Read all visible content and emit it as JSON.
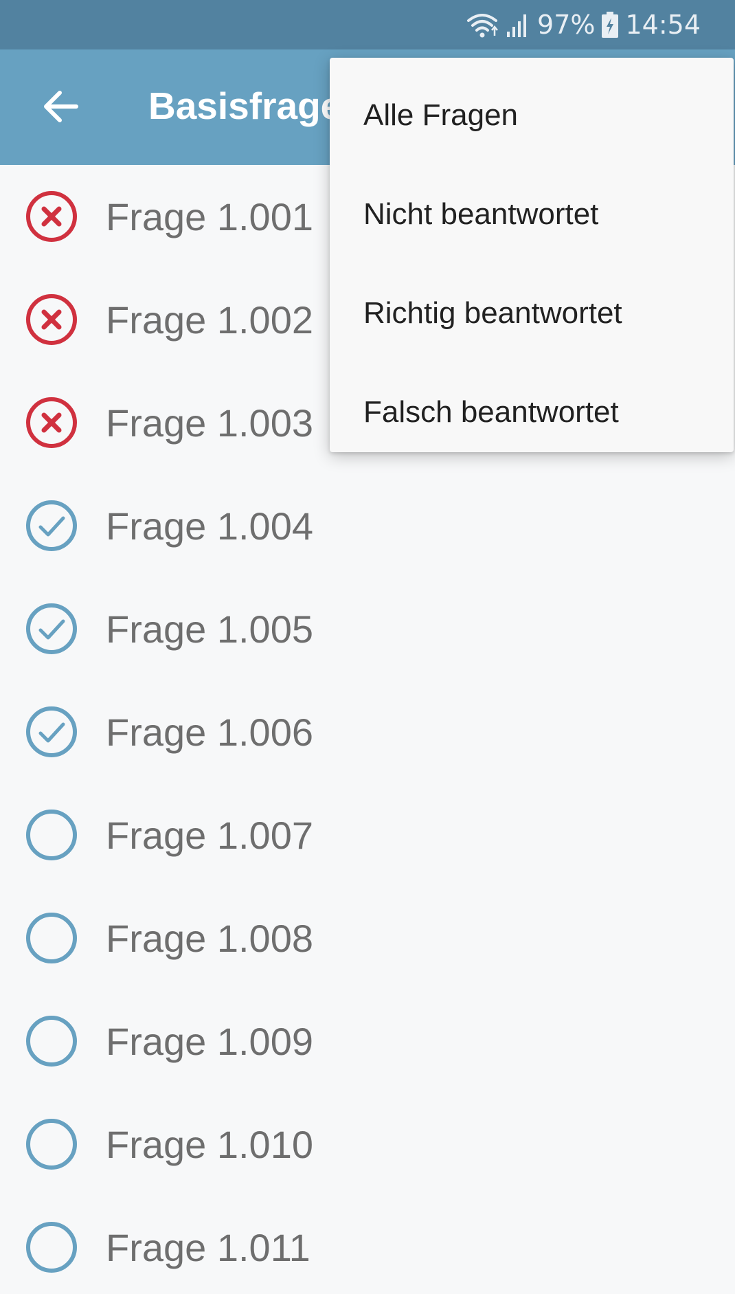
{
  "status_bar": {
    "battery": "97%",
    "time": "14:54",
    "icons": [
      "wifi-icon",
      "signal-icon",
      "battery-charging-icon"
    ]
  },
  "app_bar": {
    "back_icon": "arrow-left-icon",
    "title": "Basisfragen"
  },
  "questions": [
    {
      "label": "Frage 1.001",
      "status": "wrong"
    },
    {
      "label": "Frage 1.002",
      "status": "wrong"
    },
    {
      "label": "Frage 1.003",
      "status": "wrong"
    },
    {
      "label": "Frage 1.004",
      "status": "correct"
    },
    {
      "label": "Frage 1.005",
      "status": "correct"
    },
    {
      "label": "Frage 1.006",
      "status": "correct"
    },
    {
      "label": "Frage 1.007",
      "status": "unanswered"
    },
    {
      "label": "Frage 1.008",
      "status": "unanswered"
    },
    {
      "label": "Frage 1.009",
      "status": "unanswered"
    },
    {
      "label": "Frage 1.010",
      "status": "unanswered"
    },
    {
      "label": "Frage 1.011",
      "status": "unanswered"
    }
  ],
  "filter_menu": {
    "items": [
      "Alle Fragen",
      "Nicht beantwortet",
      "Richtig beantwortet",
      "Falsch beantwortet"
    ]
  },
  "colors": {
    "status_bar": "#5282a0",
    "app_bar": "#67a1c1",
    "wrong": "#d0313f",
    "correct": "#67a1c1",
    "unanswered": "#67a1c1"
  }
}
